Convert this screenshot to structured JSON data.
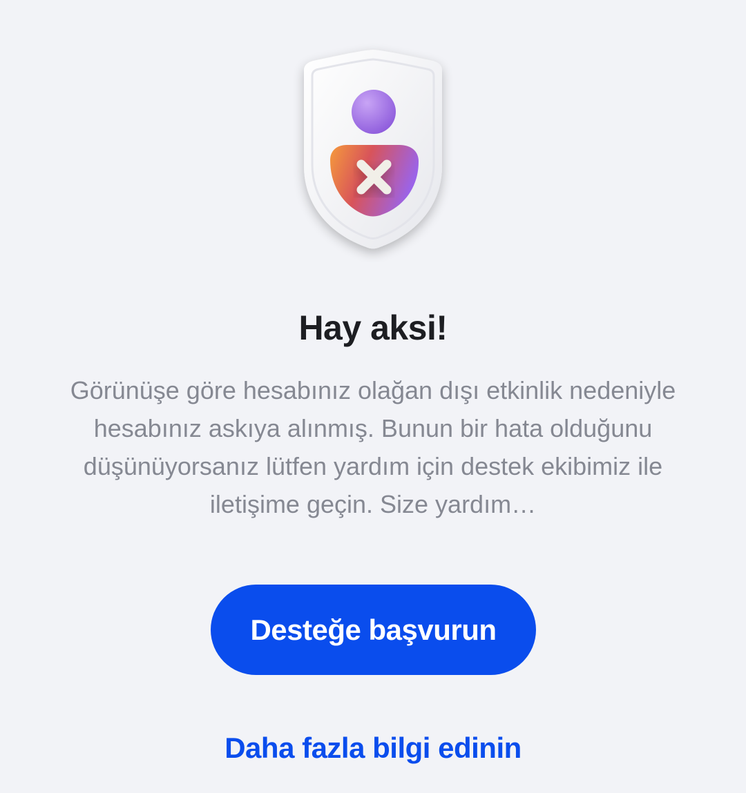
{
  "illustration": {
    "icon": "shield-user-blocked-icon",
    "colors": {
      "shield": "#f7f7f9",
      "head": "#a77be6",
      "body_orange": "#f0893a",
      "body_purple": "#9b63e8",
      "mark": "#f1efe8"
    }
  },
  "title": "Hay aksi!",
  "message": "Görünüşe göre hesabınız olağan dışı etkinlik nedeniyle hesabınız askıya alınmış. Bunun bir hata olduğunu düşünüyorsanız lütfen yardım için destek ekibimiz ile iletişime geçin. Size yardım…",
  "primary_button": {
    "label": "Desteğe başvurun",
    "color": "#0a4ded"
  },
  "secondary_link": {
    "label": "Daha fazla bilgi edinin",
    "color": "#0a4ded"
  }
}
